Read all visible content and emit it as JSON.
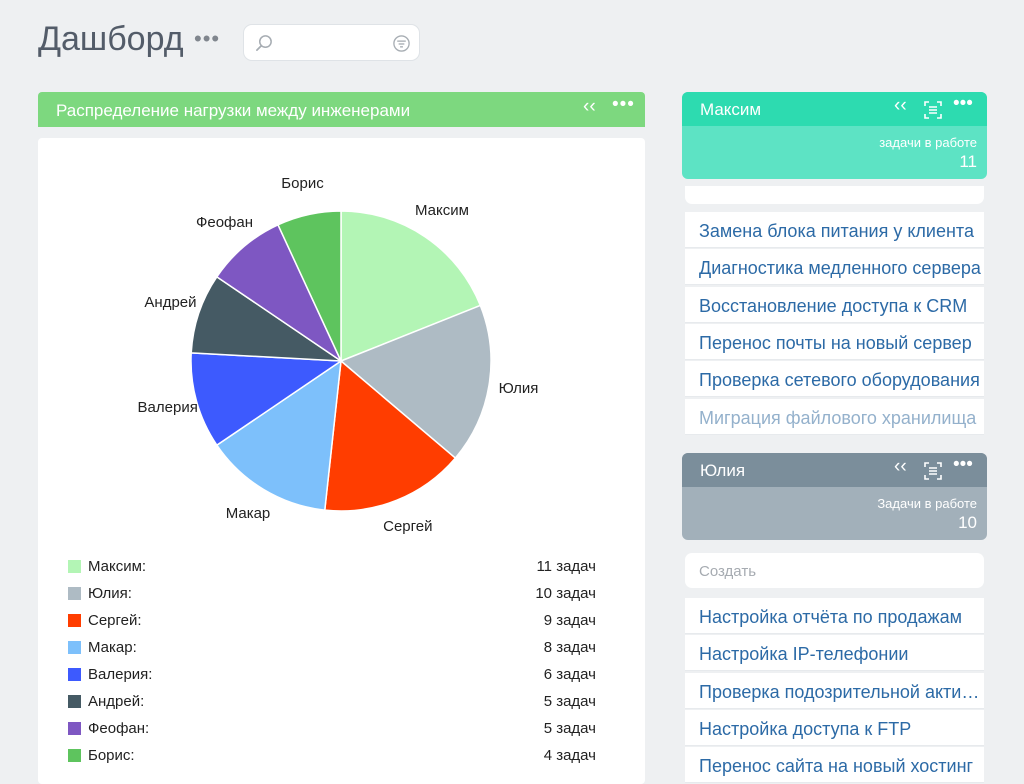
{
  "header": {
    "title": "Дашборд",
    "menu_glyph": "•••"
  },
  "widget": {
    "title": "Распределение нагрузки между инженерами",
    "collapse_glyph": "‹‹",
    "menu_glyph": "•••"
  },
  "chart_data": {
    "type": "pie",
    "slices": [
      {
        "label": "Максим",
        "value": 11,
        "color": "#b3f5b5"
      },
      {
        "label": "Юлия",
        "value": 10,
        "color": "#aebbc4"
      },
      {
        "label": "Сергей",
        "value": 9,
        "color": "#ff3d00"
      },
      {
        "label": "Макар",
        "value": 8,
        "color": "#7dc0fb"
      },
      {
        "label": "Валерия",
        "value": 6,
        "color": "#3d5afe"
      },
      {
        "label": "Андрей",
        "value": 5,
        "color": "#455a64"
      },
      {
        "label": "Феофан",
        "value": 5,
        "color": "#7e57c2"
      },
      {
        "label": "Борис",
        "value": 4,
        "color": "#5ec45e"
      }
    ]
  },
  "legend": [
    {
      "name": "Максим:",
      "value": "11 задач",
      "color": "#b3f5b5"
    },
    {
      "name": "Юлия:",
      "value": "10 задач",
      "color": "#aebbc4"
    },
    {
      "name": "Сергей:",
      "value": "9 задач",
      "color": "#ff3d00"
    },
    {
      "name": "Макар:",
      "value": "8 задач",
      "color": "#7dc0fb"
    },
    {
      "name": "Валерия:",
      "value": "6 задач",
      "color": "#3d5afe"
    },
    {
      "name": "Андрей:",
      "value": "5 задач",
      "color": "#455a64"
    },
    {
      "name": "Феофан:",
      "value": "5 задач",
      "color": "#7e57c2"
    },
    {
      "name": "Борис:",
      "value": "4 задач",
      "color": "#5ec45e"
    }
  ],
  "columns": [
    {
      "name": "Максим",
      "stat_label": "задачи в работе",
      "stat_value": "11",
      "header_color": "#2ddbb0",
      "stat_color": "#5de3c4",
      "tasks": [
        "Замена блока питания у клиента",
        "Диагностика медленного сервера",
        "Восстановление доступа к CRM",
        "Перенос почты на новый сервер",
        "Проверка сетевого оборудования",
        "Миграция файлового хранилища"
      ]
    },
    {
      "name": "Юлия",
      "stat_label": "Задачи в работе",
      "stat_value": "10",
      "header_color": "#7b8e9b",
      "stat_color": "#a2b0ba",
      "create_label": "Создать",
      "tasks": [
        "Настройка отчёта по продажам",
        "Настройка IP-телефонии",
        "Проверка подозрительной активности",
        "Настройка доступа к FTP",
        "Перенос сайта на новый хостинг"
      ]
    }
  ]
}
